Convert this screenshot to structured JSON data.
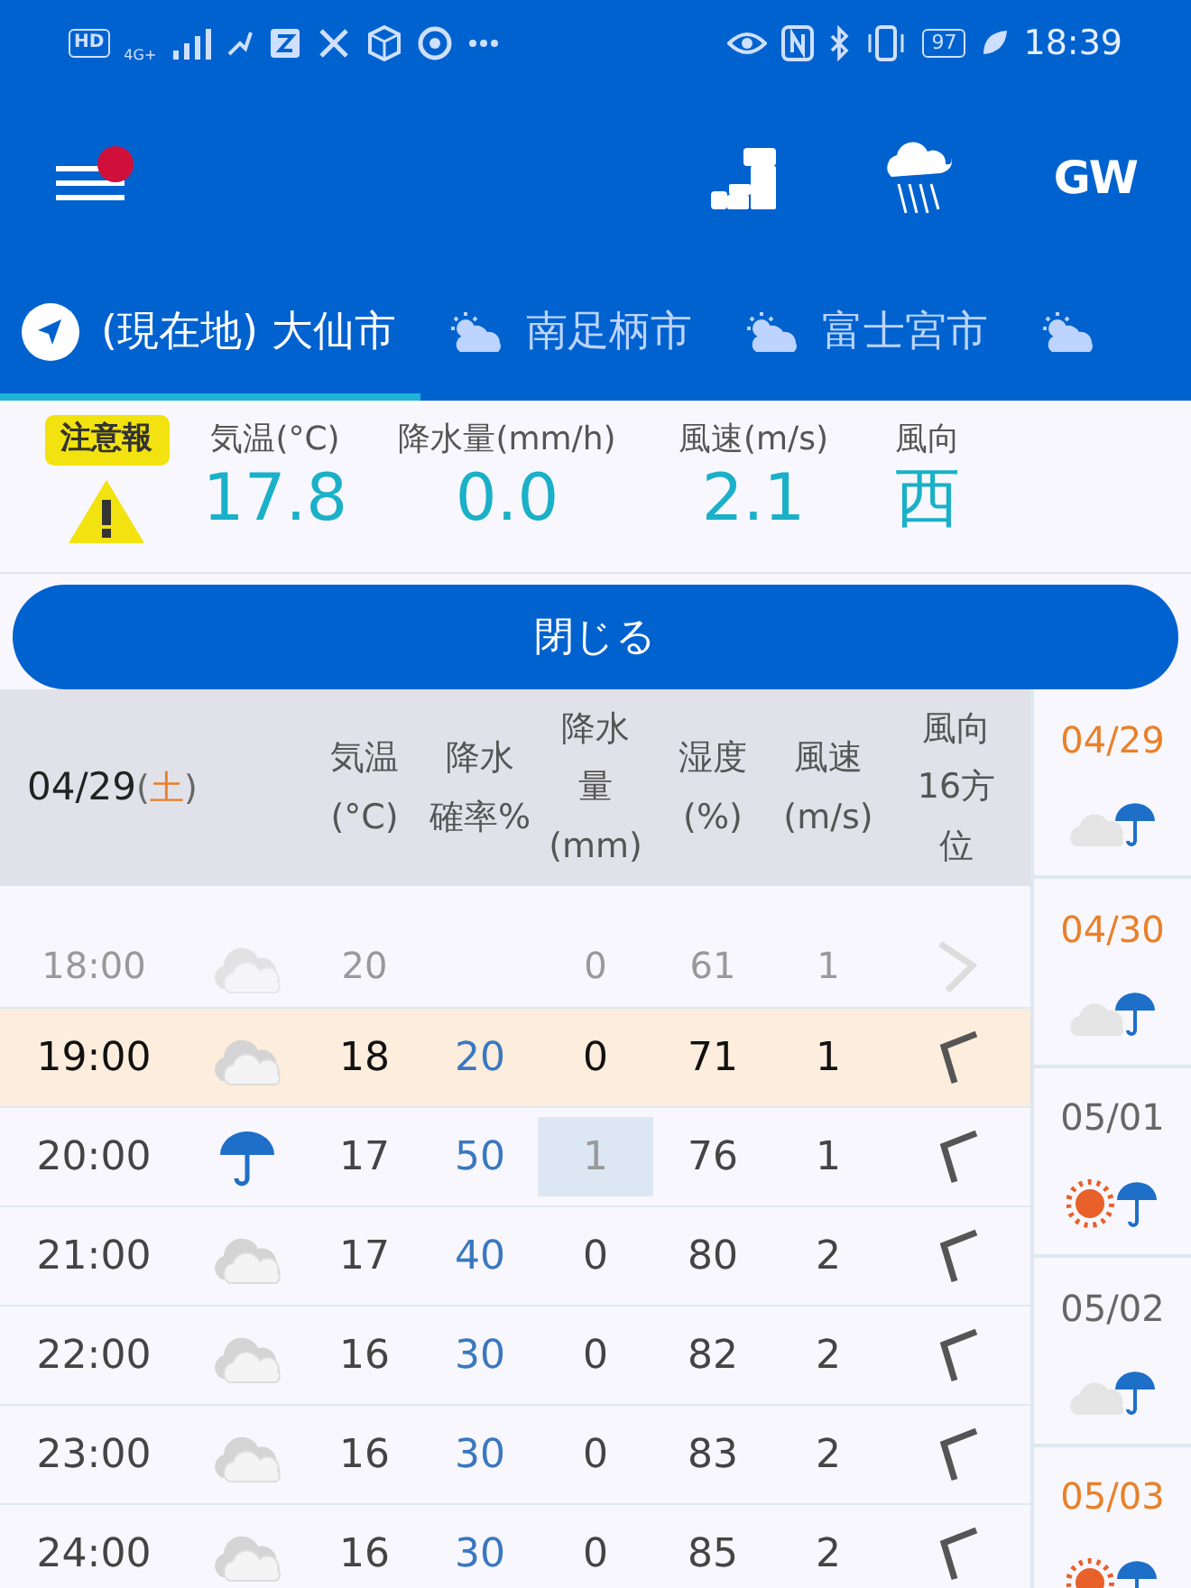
{
  "status_bar": {
    "hd": "HD",
    "network": "4G+",
    "battery": "97",
    "time": "18:39"
  },
  "toolbar": {
    "notification_dot": true,
    "gw_label": "GW"
  },
  "tabs": [
    {
      "label": "(現在地) 大仙市",
      "kind": "location",
      "selected": true
    },
    {
      "label": "南足柄市",
      "kind": "weather",
      "selected": false
    },
    {
      "label": "富士宮市",
      "kind": "weather",
      "selected": false
    },
    {
      "kind": "weather",
      "selected": false
    }
  ],
  "current": {
    "badge": "注意報",
    "columns": [
      {
        "label": "気温(°C)",
        "value": "17.8"
      },
      {
        "label": "降水量(mm/h)",
        "value": "0.0"
      },
      {
        "label": "風速(m/s)",
        "value": "2.1"
      },
      {
        "label": "風向",
        "value": "西"
      }
    ]
  },
  "close_button": "閉じる",
  "table": {
    "date": "04/29",
    "weekday": "(土)",
    "columns": [
      [
        "気温",
        "(°C)"
      ],
      [
        "降水",
        "確率%"
      ],
      [
        "降水",
        "量",
        "(mm)"
      ],
      [
        "湿度",
        "(%)"
      ],
      [
        "風速",
        "(m/s)"
      ],
      [
        "風向",
        "16方",
        "位"
      ]
    ],
    "rows": [
      {
        "time": "18:00",
        "kind": "cloudy",
        "temp": "20",
        "amount": "0",
        "humidity": "61",
        "wind": "1",
        "past": true,
        "selected": false,
        "amount_highlight": false
      },
      {
        "time": "19:00",
        "kind": "cloudy",
        "temp": "18",
        "prob": "20",
        "amount": "0",
        "humidity": "71",
        "wind": "1",
        "past": false,
        "selected": true,
        "amount_highlight": false
      },
      {
        "time": "20:00",
        "kind": "rain",
        "temp": "17",
        "prob": "50",
        "amount": "1",
        "humidity": "76",
        "wind": "1",
        "past": false,
        "selected": false,
        "amount_highlight": true
      },
      {
        "time": "21:00",
        "kind": "cloudy",
        "temp": "17",
        "prob": "40",
        "amount": "0",
        "humidity": "80",
        "wind": "2",
        "past": false,
        "selected": false,
        "amount_highlight": false
      },
      {
        "time": "22:00",
        "kind": "cloudy",
        "temp": "16",
        "prob": "30",
        "amount": "0",
        "humidity": "82",
        "wind": "2",
        "past": false,
        "selected": false,
        "amount_highlight": false
      },
      {
        "time": "23:00",
        "kind": "cloudy",
        "temp": "16",
        "prob": "30",
        "amount": "0",
        "humidity": "83",
        "wind": "2",
        "past": false,
        "selected": false,
        "amount_highlight": false
      },
      {
        "time": "24:00",
        "kind": "cloudy",
        "temp": "16",
        "prob": "30",
        "amount": "0",
        "humidity": "85",
        "wind": "2",
        "past": false,
        "selected": false,
        "amount_highlight": false
      }
    ]
  },
  "days": [
    {
      "date": "04/29",
      "holiday": true,
      "kind": "cloud_rain"
    },
    {
      "date": "04/30",
      "holiday": true,
      "kind": "cloud_rain"
    },
    {
      "date": "05/01",
      "holiday": false,
      "kind": "sun_rain"
    },
    {
      "date": "05/02",
      "holiday": false,
      "kind": "cloud_rain"
    },
    {
      "date": "05/03",
      "holiday": true,
      "kind": "sun_rain"
    }
  ]
}
